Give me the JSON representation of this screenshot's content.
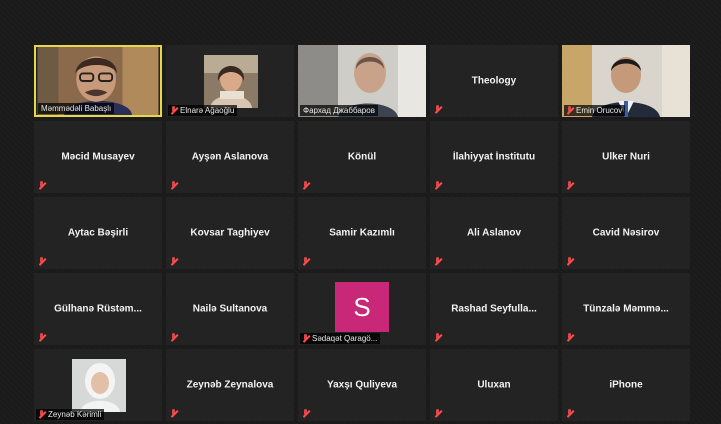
{
  "meeting": {
    "participants": [
      {
        "name": "Məmmədəli Babaşlı",
        "style": "video-label",
        "video": "man-glasses",
        "active": true,
        "muted": false
      },
      {
        "name": "Elnarə Ağaoğlu",
        "style": "video-label",
        "video": "woman-small",
        "muted": true
      },
      {
        "name": "Фархад Джаббаров",
        "style": "video-label",
        "video": "man-bald",
        "muted": false
      },
      {
        "name": "Theology",
        "style": "center",
        "muted": true
      },
      {
        "name": "Emin Orucov",
        "style": "video-label",
        "video": "man-suit",
        "muted": true
      },
      {
        "name": "Məcid Musayev",
        "style": "center",
        "muted": true
      },
      {
        "name": "Ayşən Aslanova",
        "style": "center",
        "muted": true
      },
      {
        "name": "Könül",
        "style": "center",
        "muted": true
      },
      {
        "name": "İlahiyyat İnstitutu",
        "style": "center",
        "muted": true
      },
      {
        "name": "Ulker Nuri",
        "style": "center",
        "muted": true
      },
      {
        "name": "Aytac Bəşirli",
        "style": "center",
        "muted": true
      },
      {
        "name": "Kovsar Taghiyev",
        "style": "center",
        "muted": true
      },
      {
        "name": "Samir Kazımlı",
        "style": "center",
        "muted": true
      },
      {
        "name": "Ali Aslanov",
        "style": "center",
        "muted": true
      },
      {
        "name": "Cavid Nəsirov",
        "style": "center",
        "muted": true
      },
      {
        "name": "Gülhanə  Rüstəm...",
        "style": "center",
        "muted": true
      },
      {
        "name": "Nailə Sultanova",
        "style": "center",
        "muted": true
      },
      {
        "name": "Sədaqət Qaragö...",
        "style": "avatar-label",
        "initial": "S",
        "avatar_color": "#c92777",
        "muted": true
      },
      {
        "name": "Rashad  Seyfulla...",
        "style": "center",
        "muted": true
      },
      {
        "name": "Tünzalə  Məmmə...",
        "style": "center",
        "muted": true
      },
      {
        "name": "Zeynəb Kərimli",
        "style": "video-label",
        "video": "woman-hijab",
        "muted": true
      },
      {
        "name": "Zeynəb Zeynalova",
        "style": "center",
        "muted": true
      },
      {
        "name": "Yaxşı Quliyeva",
        "style": "center",
        "muted": true
      },
      {
        "name": "Uluxan",
        "style": "center",
        "muted": true
      },
      {
        "name": "iPhone",
        "style": "center",
        "muted": true
      }
    ]
  }
}
